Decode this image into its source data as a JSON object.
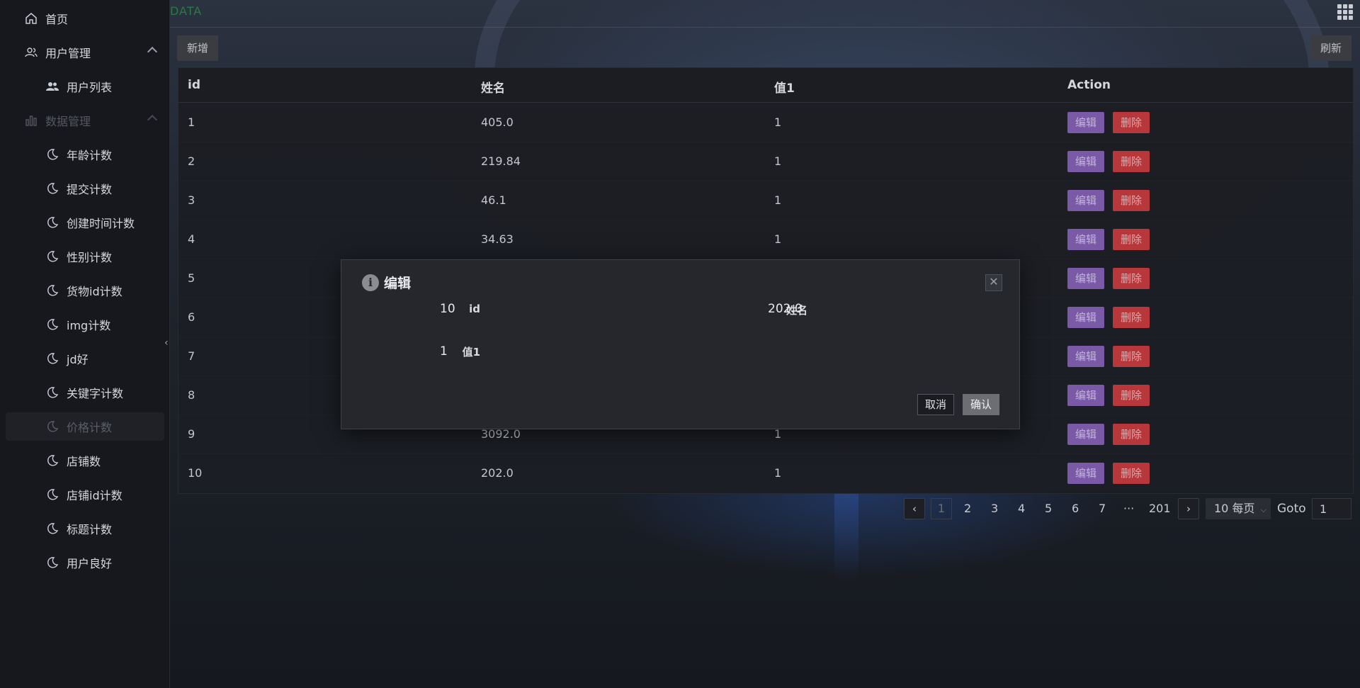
{
  "brand": "DATA",
  "sidebar": {
    "home": "首页",
    "user_mgmt": "用户管理",
    "user_list": "用户列表",
    "data_mgmt": "数据管理",
    "items": [
      "年龄计数",
      "提交计数",
      "创建时间计数",
      "性别计数",
      "货物id计数",
      "img计数",
      "jd好",
      "关键字计数",
      "价格计数",
      "店铺数",
      "店铺id计数",
      "标题计数",
      "用户良好"
    ]
  },
  "toolbar": {
    "add_label": "新增",
    "refresh_label": "刷新"
  },
  "table": {
    "columns": [
      "id",
      "姓名",
      "值1",
      "Action"
    ],
    "edit_label": "编辑",
    "delete_label": "删除",
    "rows": [
      {
        "id": "1",
        "name": "405.0",
        "v1": "1"
      },
      {
        "id": "2",
        "name": "219.84",
        "v1": "1"
      },
      {
        "id": "3",
        "name": "46.1",
        "v1": "1"
      },
      {
        "id": "4",
        "name": "34.63",
        "v1": "1"
      },
      {
        "id": "5",
        "name": "",
        "v1": ""
      },
      {
        "id": "6",
        "name": "",
        "v1": ""
      },
      {
        "id": "7",
        "name": "",
        "v1": ""
      },
      {
        "id": "8",
        "name": "",
        "v1": ""
      },
      {
        "id": "9",
        "name": "3092.0",
        "v1": "1"
      },
      {
        "id": "10",
        "name": "202.0",
        "v1": "1"
      }
    ]
  },
  "pagination": {
    "prev": "‹",
    "next": "›",
    "current": "1",
    "pages": [
      "2",
      "3",
      "4",
      "5",
      "6",
      "7"
    ],
    "ellipsis": "···",
    "last": "201",
    "page_size": "10 每页",
    "goto_label": "Goto",
    "goto_value": "1"
  },
  "modal": {
    "title": "编辑",
    "info_icon": "i",
    "close": "✕",
    "fields": {
      "id_label": "id",
      "id_value": "10",
      "name_label": "姓名",
      "name_value": "202.0",
      "v1_label": "值1",
      "v1_value": "1"
    },
    "cancel_label": "取消",
    "ok_label": "确认"
  }
}
